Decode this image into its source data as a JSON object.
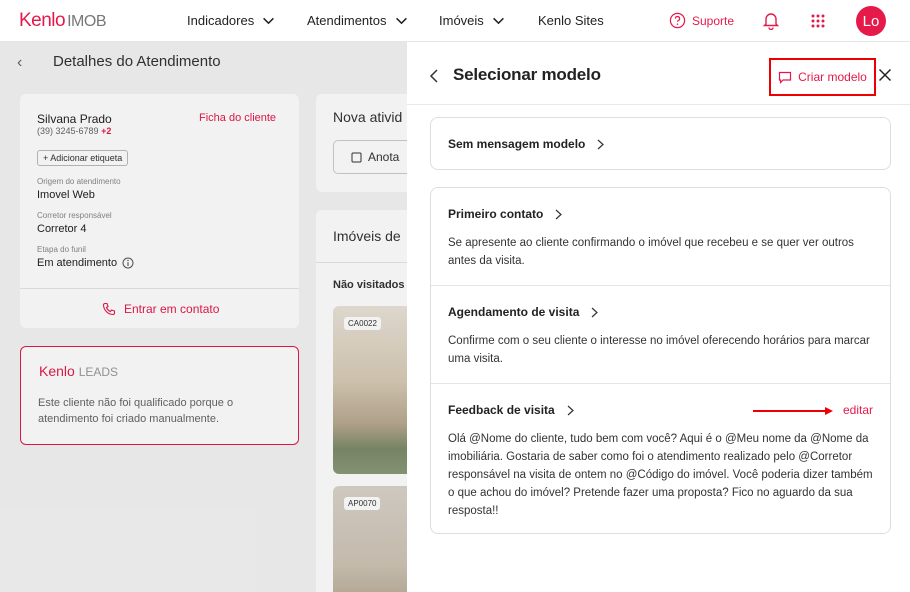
{
  "brand": {
    "logo": "Kenlo",
    "product": "IMOB"
  },
  "nav": {
    "items": [
      {
        "label": "Indicadores"
      },
      {
        "label": "Atendimentos"
      },
      {
        "label": "Imóveis"
      },
      {
        "label": "Kenlo Sites"
      }
    ],
    "support": "Suporte",
    "avatar": "Lo"
  },
  "background": {
    "title": "Detalhes do Atendimento",
    "client": {
      "name": "Silvana Prado",
      "phone": "(39) 3245-6789",
      "phone_extra": "+2",
      "ficha": "Ficha do cliente",
      "add_tag": "Adicionar etiqueta",
      "origin_label": "Origem do atendimento",
      "origin": "Imovel Web",
      "broker_label": "Corretor responsável",
      "broker": "Corretor 4",
      "stage_label": "Etapa do funil",
      "stage": "Em atendimento",
      "contact": "Entrar em contato"
    },
    "leads": {
      "logo": "Kenlo",
      "product": "LEADS",
      "text": "Este cliente não foi qualificado porque o atendimento foi criado manualmente."
    },
    "activity": {
      "title": "Nova ativid",
      "button": "Anota"
    },
    "properties": {
      "title": "Imóveis de",
      "not_visited": "Não visitados",
      "codes": [
        "CA0022",
        "AP0070"
      ]
    }
  },
  "drawer": {
    "title": "Selecionar modelo",
    "create_button": "Criar modelo",
    "no_template": "Sem mensagem modelo",
    "templates": [
      {
        "title": "Primeiro contato",
        "body": "Se apresente ao cliente confirmando o imóvel que recebeu e se quer ver outros antes da visita."
      },
      {
        "title": "Agendamento de visita",
        "body": "Confirme com o seu cliente o interesse no imóvel oferecendo horários para marcar uma visita."
      },
      {
        "title": "Feedback de visita",
        "body": "Olá @Nome do cliente, tudo bem com você? Aqui é o @Meu nome da @Nome da imobiliária. Gostaria de saber como foi o atendimento realizado pelo @Corretor responsável na visita de ontem no @Código do imóvel. Você poderia dizer também o que achou do imóvel? Pretende fazer uma proposta? Fico no aguardo da sua resposta!!",
        "edit": "editar"
      }
    ]
  },
  "colors": {
    "accent": "#e6194b",
    "highlight_box": "#ee0000"
  }
}
